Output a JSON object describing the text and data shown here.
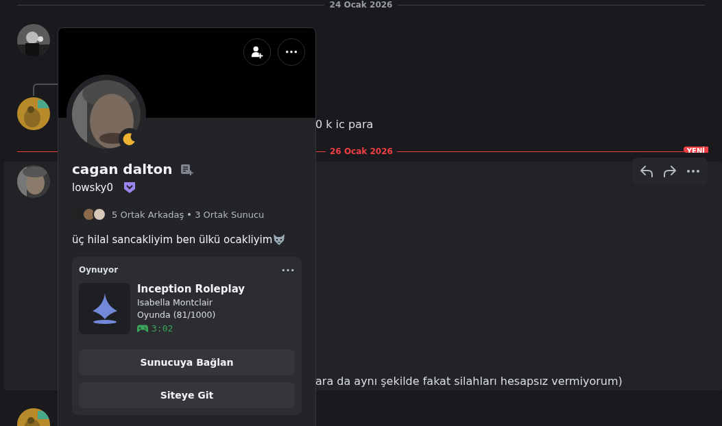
{
  "chat": {
    "dividers": [
      {
        "date": "24 Ocak 2026",
        "new": false
      },
      {
        "date": "26 Ocak 2026",
        "new": true,
        "badge": "YENİ"
      }
    ],
    "messages": [
      "0 k ic para",
      "ara da aynı şekilde fakat silahları hesapsız vermiyorum)"
    ]
  },
  "profile": {
    "display_name": "cagan dalton",
    "username": "lowsky0",
    "idle": true,
    "mutual_friends": "5 Ortak Arkadaş",
    "mutual_servers": "3 Ortak Sunucu",
    "bio": "üç hilal sancakliyim ben ülkü ocakliyim",
    "activity": {
      "header": "Oynuyor",
      "name": "Inception Roleplay",
      "details": "Isabella Montclair",
      "state": "Oyunda (81/1000)",
      "elapsed": "3:02",
      "buttons": [
        "Sunucuya Bağlan",
        "Siteye Git"
      ]
    }
  }
}
